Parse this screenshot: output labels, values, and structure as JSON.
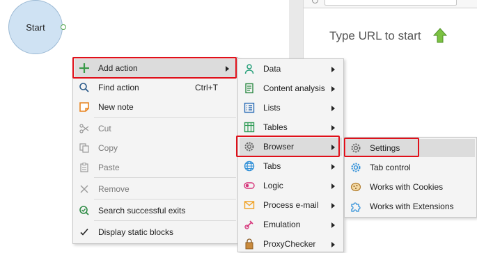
{
  "canvas": {
    "start_node_label": "Start"
  },
  "browser": {
    "hint_text": "Type URL to start"
  },
  "context_menu": {
    "items": [
      {
        "label": "Add action",
        "icon": "plus-icon",
        "submenu": true
      },
      {
        "label": "Find action",
        "icon": "search-icon",
        "shortcut": "Ctrl+T"
      },
      {
        "label": "New note",
        "icon": "note-icon"
      },
      {
        "label": "Cut",
        "icon": "scissors-icon",
        "disabled": true
      },
      {
        "label": "Copy",
        "icon": "copy-icon",
        "disabled": true
      },
      {
        "label": "Paste",
        "icon": "paste-icon",
        "disabled": true
      },
      {
        "label": "Remove",
        "icon": "close-icon",
        "disabled": true
      },
      {
        "label": "Search successful exits",
        "icon": "search-check-icon"
      },
      {
        "label": "Display static blocks",
        "icon": "checkmark-icon"
      }
    ]
  },
  "add_action_submenu": {
    "items": [
      {
        "label": "Data",
        "icon": "person-icon"
      },
      {
        "label": "Content analysis",
        "icon": "document-icon"
      },
      {
        "label": "Lists",
        "icon": "list-icon"
      },
      {
        "label": "Tables",
        "icon": "table-icon"
      },
      {
        "label": "Browser",
        "icon": "gear-icon"
      },
      {
        "label": "Tabs",
        "icon": "globe-icon"
      },
      {
        "label": "Logic",
        "icon": "toggle-icon"
      },
      {
        "label": "Process e-mail",
        "icon": "envelope-icon"
      },
      {
        "label": "Emulation",
        "icon": "emulation-icon"
      },
      {
        "label": "ProxyChecker",
        "icon": "proxy-icon"
      }
    ]
  },
  "browser_submenu": {
    "items": [
      {
        "label": "Settings",
        "icon": "gear-icon"
      },
      {
        "label": "Tab control",
        "icon": "tab-gear-icon"
      },
      {
        "label": "Works with Cookies",
        "icon": "cookie-icon"
      },
      {
        "label": "Works with Extensions",
        "icon": "puzzle-icon"
      }
    ]
  }
}
